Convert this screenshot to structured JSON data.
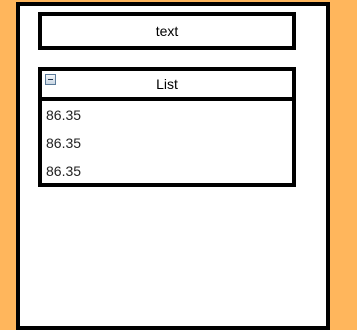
{
  "colors": {
    "background": "#FFB65C",
    "panel": "#FFFFFF",
    "border": "#000000"
  },
  "text_box": {
    "label": "text"
  },
  "list_panel": {
    "title": "List",
    "collapse_icon": "collapse-minus-icon",
    "items": [
      {
        "value": "86.35"
      },
      {
        "value": "86.35"
      },
      {
        "value": "86.35"
      }
    ]
  }
}
